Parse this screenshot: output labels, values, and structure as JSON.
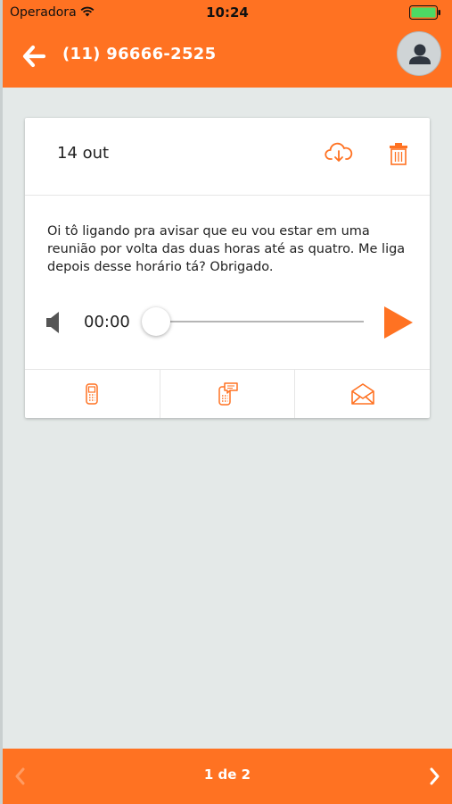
{
  "status_bar": {
    "carrier": "Operadora",
    "time": "10:24",
    "icons": [
      "wifi-icon",
      "battery-icon"
    ]
  },
  "header": {
    "title": "(11) 96666-2525",
    "back_icon": "arrow-left-icon",
    "avatar_icon": "user-avatar-icon"
  },
  "message_card": {
    "date": "14 out",
    "transcription": "Oi tô ligando pra avisar que eu vou estar em uma reunião por volta das duas horas até as quatro. Me liga depois desse horário tá? Obrigado.",
    "player": {
      "elapsed": "00:00",
      "progress": 0
    },
    "actions": [
      "call-phone-icon",
      "sms-message-icon",
      "email-envelope-icon"
    ]
  },
  "pagination": {
    "label": "1 de 2"
  },
  "colors": {
    "accent": "#ff7222",
    "background": "#e4e9e8"
  }
}
